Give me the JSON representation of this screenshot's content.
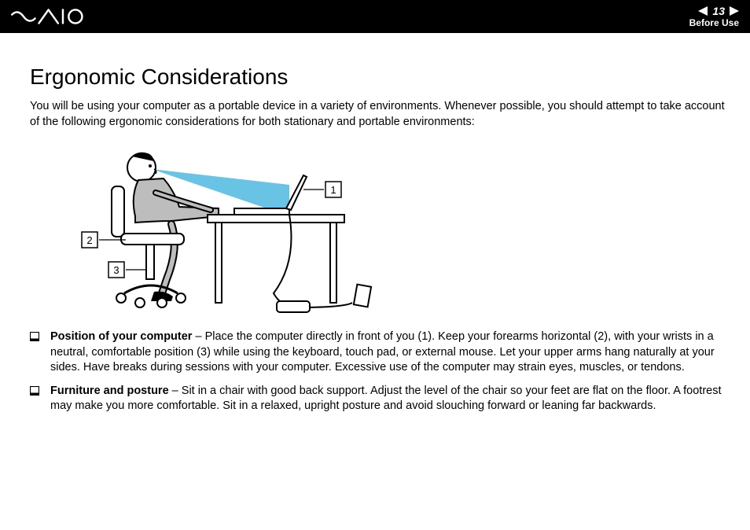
{
  "header": {
    "page_number": "13",
    "section": "Before Use"
  },
  "content": {
    "title": "Ergonomic Considerations",
    "intro": "You will be using your computer as a portable device in a variety of environments. Whenever possible, you should attempt to take account of the following ergonomic considerations for both stationary and portable environments:",
    "figure_labels": {
      "l1": "1",
      "l2": "2",
      "l3": "3"
    },
    "bullets": [
      {
        "title": "Position of your computer",
        "text": " – Place the computer directly in front of you (1). Keep your forearms horizontal (2), with your wrists in a neutral, comfortable position (3) while using the keyboard, touch pad, or external mouse. Let your upper arms hang naturally at your sides. Have breaks during sessions with your computer. Excessive use of the computer may strain eyes, muscles, or tendons."
      },
      {
        "title": "Furniture and posture",
        "text": " – Sit in a chair with good back support. Adjust the level of the chair so your feet are flat on the floor. A footrest may make you more comfortable. Sit in a relaxed, upright posture and avoid slouching forward or leaning far backwards."
      }
    ]
  }
}
